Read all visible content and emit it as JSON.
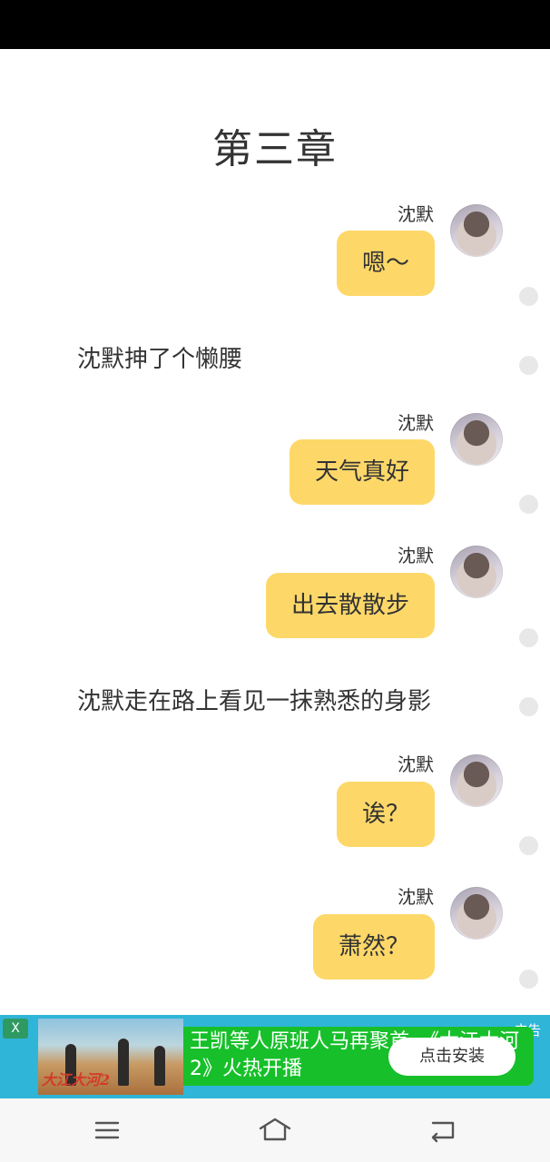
{
  "chapter": {
    "title": "第三章"
  },
  "messages": [
    {
      "type": "chat",
      "name": "沈默",
      "text": "嗯～"
    },
    {
      "type": "narration",
      "text": "沈默抻了个懒腰"
    },
    {
      "type": "chat",
      "name": "沈默",
      "text": "天气真好"
    },
    {
      "type": "chat",
      "name": "沈默",
      "text": "出去散散步"
    },
    {
      "type": "narration",
      "text": "沈默走在路上看见一抹熟悉的身影"
    },
    {
      "type": "chat",
      "name": "沈默",
      "text": "诶？"
    },
    {
      "type": "chat",
      "name": "沈默",
      "text": "萧然？"
    }
  ],
  "ad": {
    "label": "广告",
    "close": "X",
    "image_caption": "大江大河2",
    "headline": "王凯等人原班人马再聚首，《大江大河2》火热开播",
    "button": "点击安装",
    "colors": {
      "background": "#2fb5d8",
      "text_block": "#17c02a"
    }
  },
  "navbar": {
    "icons": [
      "menu-icon",
      "home-icon",
      "back-icon"
    ]
  },
  "colors": {
    "bubble": "#fdd869",
    "dot": "#e8e8e8"
  }
}
